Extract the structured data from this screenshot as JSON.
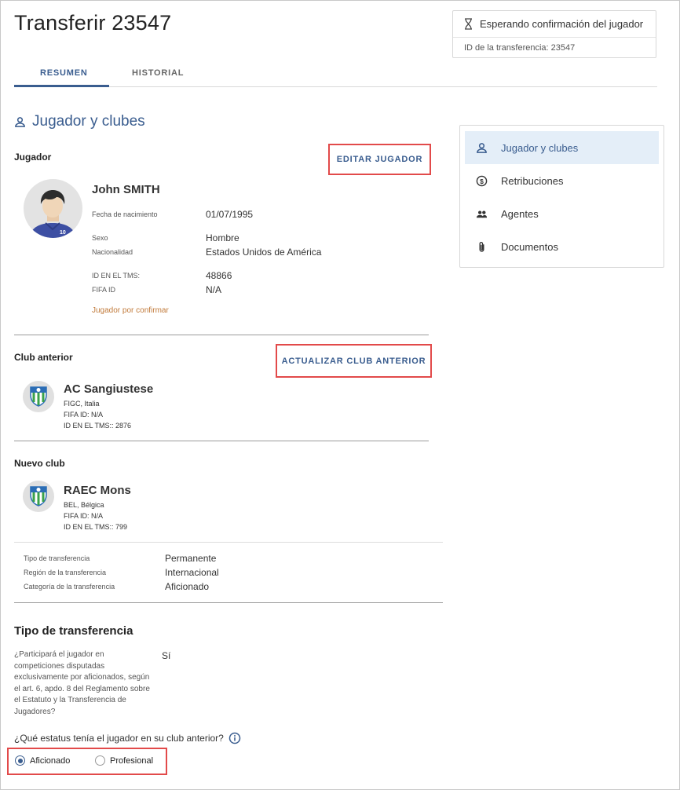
{
  "page": {
    "title": "Transferir 23547"
  },
  "status": {
    "label": "Esperando confirmación del jugador",
    "transfer_id": "ID de la transferencia: 23547"
  },
  "tabs": [
    {
      "label": "RESUMEN",
      "active": true
    },
    {
      "label": "HISTORIAL",
      "active": false
    }
  ],
  "section": {
    "title": "Jugador y clubes"
  },
  "player": {
    "heading": "Jugador",
    "edit_label": "EDITAR JUGADOR",
    "name": "John SMITH",
    "shirt_number": "10",
    "dob_label": "Fecha de nacimiento",
    "dob": "01/07/1995",
    "sex_label": "Sexo",
    "sex": "Hombre",
    "nationality_label": "Nacionalidad",
    "nationality": "Estados Unidos de América",
    "tms_label": "ID EN EL TMS:",
    "tms": "48866",
    "fifa_label": "FIFA ID",
    "fifa": "N/A",
    "pending": "Jugador por confirmar"
  },
  "previous_club": {
    "heading": "Club anterior",
    "update_label": "ACTUALIZAR CLUB ANTERIOR",
    "name": "AC Sangiustese",
    "association": "FIGC, Italia",
    "fifa": "FIFA ID: N/A",
    "tms": "ID EN EL TMS:: 2876"
  },
  "new_club": {
    "heading": "Nuevo club",
    "name": "RAEC Mons",
    "association": "BEL, Bélgica",
    "fifa": "FIFA ID: N/A",
    "tms": "ID EN EL TMS:: 799"
  },
  "transfer_details": [
    {
      "label": "Tipo de transferencia",
      "value": "Permanente"
    },
    {
      "label": "Región de la transferencia",
      "value": "Internacional"
    },
    {
      "label": "Categoría de la transferencia",
      "value": "Aficionado"
    }
  ],
  "sidebar": {
    "items": [
      {
        "label": "Jugador y clubes",
        "icon": "person-icon",
        "active": true
      },
      {
        "label": "Retribuciones",
        "icon": "dollar-circle-icon",
        "active": false
      },
      {
        "label": "Agentes",
        "icon": "people-icon",
        "active": false
      },
      {
        "label": "Documentos",
        "icon": "paperclip-icon",
        "active": false
      }
    ]
  },
  "transfer_type": {
    "heading": "Tipo de transferencia",
    "question": "¿Participará el jugador en competiciones disputadas exclusivamente por aficionados, según el art. 6, apdo. 8 del Reglamento sobre el Estatuto y la Transferencia de Jugadores?",
    "answer": "Sí",
    "status_question": "¿Qué estatus tenía el jugador en su club anterior?",
    "options": [
      {
        "label": "Aficionado",
        "selected": true
      },
      {
        "label": "Profesional",
        "selected": false
      }
    ]
  },
  "colors": {
    "accent": "#3a5d8f",
    "highlight": "#e24a4a",
    "warning": "#c17a3a",
    "active_bg": "#e4eef8"
  }
}
